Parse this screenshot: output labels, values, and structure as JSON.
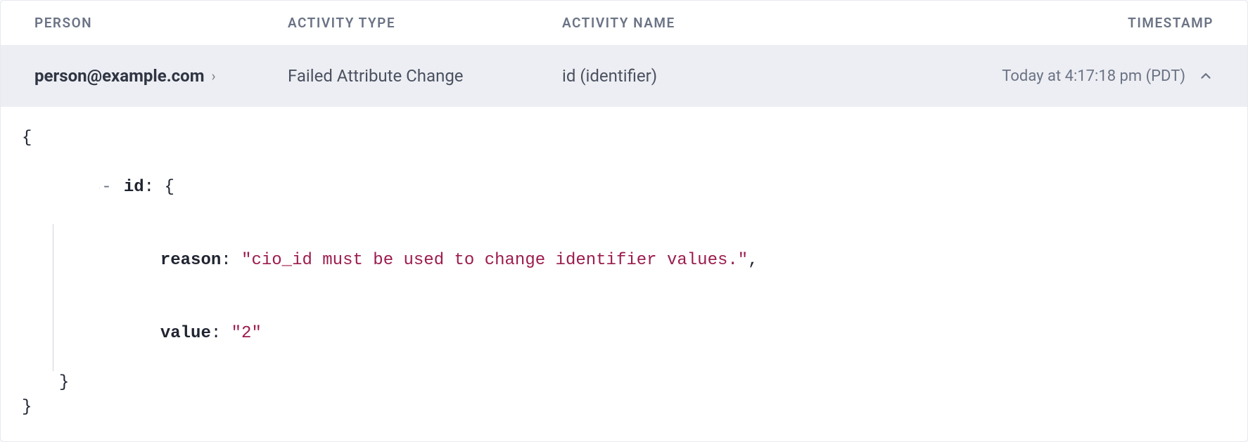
{
  "table": {
    "headers": {
      "person": "Person",
      "activity_type": "Activity Type",
      "activity_name": "Activity Name",
      "timestamp": "Timestamp"
    },
    "row": {
      "person": "person@example.com",
      "activity_type": "Failed Attribute Change",
      "activity_name": "id (identifier)",
      "timestamp": "Today at 4:17:18 pm (PDT)"
    }
  },
  "details": {
    "key": "id",
    "reason_key": "reason",
    "reason_value": "\"cio_id must be used to change identifier values.\"",
    "value_key": "value",
    "value_value": "\"2\""
  },
  "glyphs": {
    "chevron_right": "›",
    "collapse": "-"
  }
}
